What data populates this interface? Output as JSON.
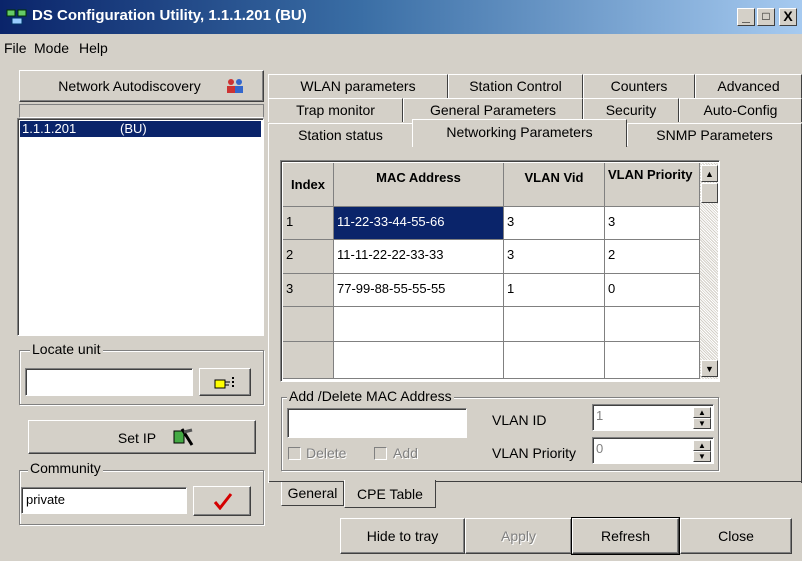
{
  "window": {
    "title": "DS Configuration Utility, 1.1.1.201  (BU)",
    "min": "_",
    "max": "□",
    "close": "X"
  },
  "menu": [
    {
      "label": "File"
    },
    {
      "label": "Mode"
    },
    {
      "label": "Help"
    }
  ],
  "left": {
    "autodiscovery_label": "Network Autodiscovery",
    "devices": [
      {
        "ip": "1.1.1.201",
        "tag": "(BU)"
      }
    ],
    "locate": {
      "group_label": "Locate unit",
      "value": ""
    },
    "set_ip_label": "Set IP",
    "community": {
      "group_label": "Community",
      "value": "private"
    }
  },
  "tabs": {
    "row1": [
      "WLAN parameters",
      "Station Control",
      "Counters",
      "Advanced"
    ],
    "row2": [
      "Trap monitor",
      "General Parameters",
      "Security",
      "Auto-Config"
    ],
    "row3": [
      "Station status",
      "Networking Parameters",
      "SNMP Parameters"
    ],
    "active": "Networking Parameters"
  },
  "grid": {
    "headers": {
      "index": "Index",
      "mac": "MAC Address",
      "vlan_vid": "VLAN Vid",
      "vlan_priority": "VLAN Priority"
    },
    "rows": [
      {
        "index": "1",
        "mac": "11-22-33-44-55-66",
        "vid": "3",
        "priority": "3"
      },
      {
        "index": "2",
        "mac": "11-11-22-22-33-33",
        "vid": "3",
        "priority": "2"
      },
      {
        "index": "3",
        "mac": "77-99-88-55-55-55",
        "vid": "1",
        "priority": "0"
      },
      {
        "index": "",
        "mac": "",
        "vid": "",
        "priority": ""
      },
      {
        "index": "",
        "mac": "",
        "vid": "",
        "priority": ""
      }
    ]
  },
  "add_delete": {
    "group_label": "Add /Delete MAC Address",
    "mac_value": "",
    "delete_label": "Delete",
    "add_label": "Add",
    "vlan_id_label": "VLAN ID",
    "vlan_id_value": "1",
    "vlan_priority_label": "VLAN Priority",
    "vlan_priority_value": "0"
  },
  "bottom_tabs": [
    "General",
    "CPE Table"
  ],
  "footer": {
    "hide": "Hide to tray",
    "apply": "Apply",
    "refresh": "Refresh",
    "close": "Close"
  },
  "colors": {
    "selection": "#0a246a",
    "title_start": "#0a246a",
    "checkmark": "#d40000"
  },
  "icons": [
    "network-autodiscovery-icon",
    "locate-icon",
    "set-ip-icon",
    "checkmark-icon"
  ]
}
